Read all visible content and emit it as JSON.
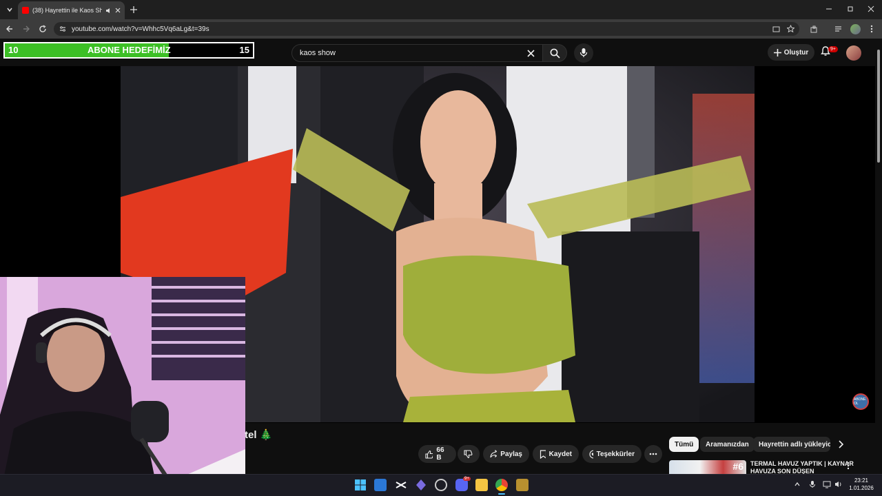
{
  "browser": {
    "tab_title": "(38) Hayrettin ile Kaos Show",
    "url": "youtube.com/watch?v=Whhc5Vq6aLg&t=39s"
  },
  "overlay": {
    "goal_start": "10",
    "goal_label": "ABONE HEDEFİMİZ",
    "goal_end": "15",
    "goal_progress_fraction": 0.66,
    "fill_color": "#3cbf25"
  },
  "youtube": {
    "search_value": "kaos show",
    "create_label": "Oluştur",
    "notification_badge": "9+",
    "title_fragment": "tel 🎄",
    "like_count": "66 B",
    "share_label": "Paylaş",
    "save_label": "Kaydet",
    "thanks_label": "Teşekkürler",
    "watermark_label": "ABONE OL",
    "chips": [
      "Tümü",
      "Aramanızdan",
      "Hayrettin adlı yükleyiciden"
    ],
    "recommendation": {
      "title": "TERMAL HAVUZ YAPTIK | KAYNAR HAVUZA SON DÜŞEN",
      "thumb_tag": "#6"
    }
  },
  "taskbar": {
    "time": "23:21",
    "date": "1.01.2026",
    "discord_badge": "9+"
  },
  "colors": {
    "yt_background": "#0f0f0f",
    "accent_red": "#ff0000",
    "taskbar": "#1c1c24"
  }
}
